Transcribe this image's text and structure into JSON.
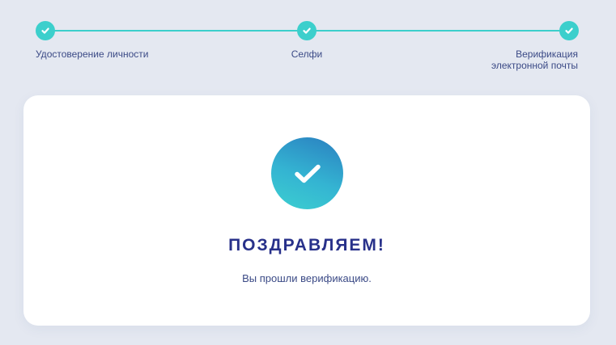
{
  "stepper": {
    "steps": [
      {
        "label": "Удостоверение личности",
        "status": "completed"
      },
      {
        "label": "Селфи",
        "status": "completed"
      },
      {
        "label": "Верификация\nэлектронной почты",
        "status": "completed"
      }
    ],
    "accent_color": "#3ccfcc"
  },
  "card": {
    "icon": "checkmark-icon",
    "title": "ПОЗДРАВЛЯЕМ!",
    "subtitle": "Вы прошли верификацию.",
    "title_color": "#28318a"
  }
}
